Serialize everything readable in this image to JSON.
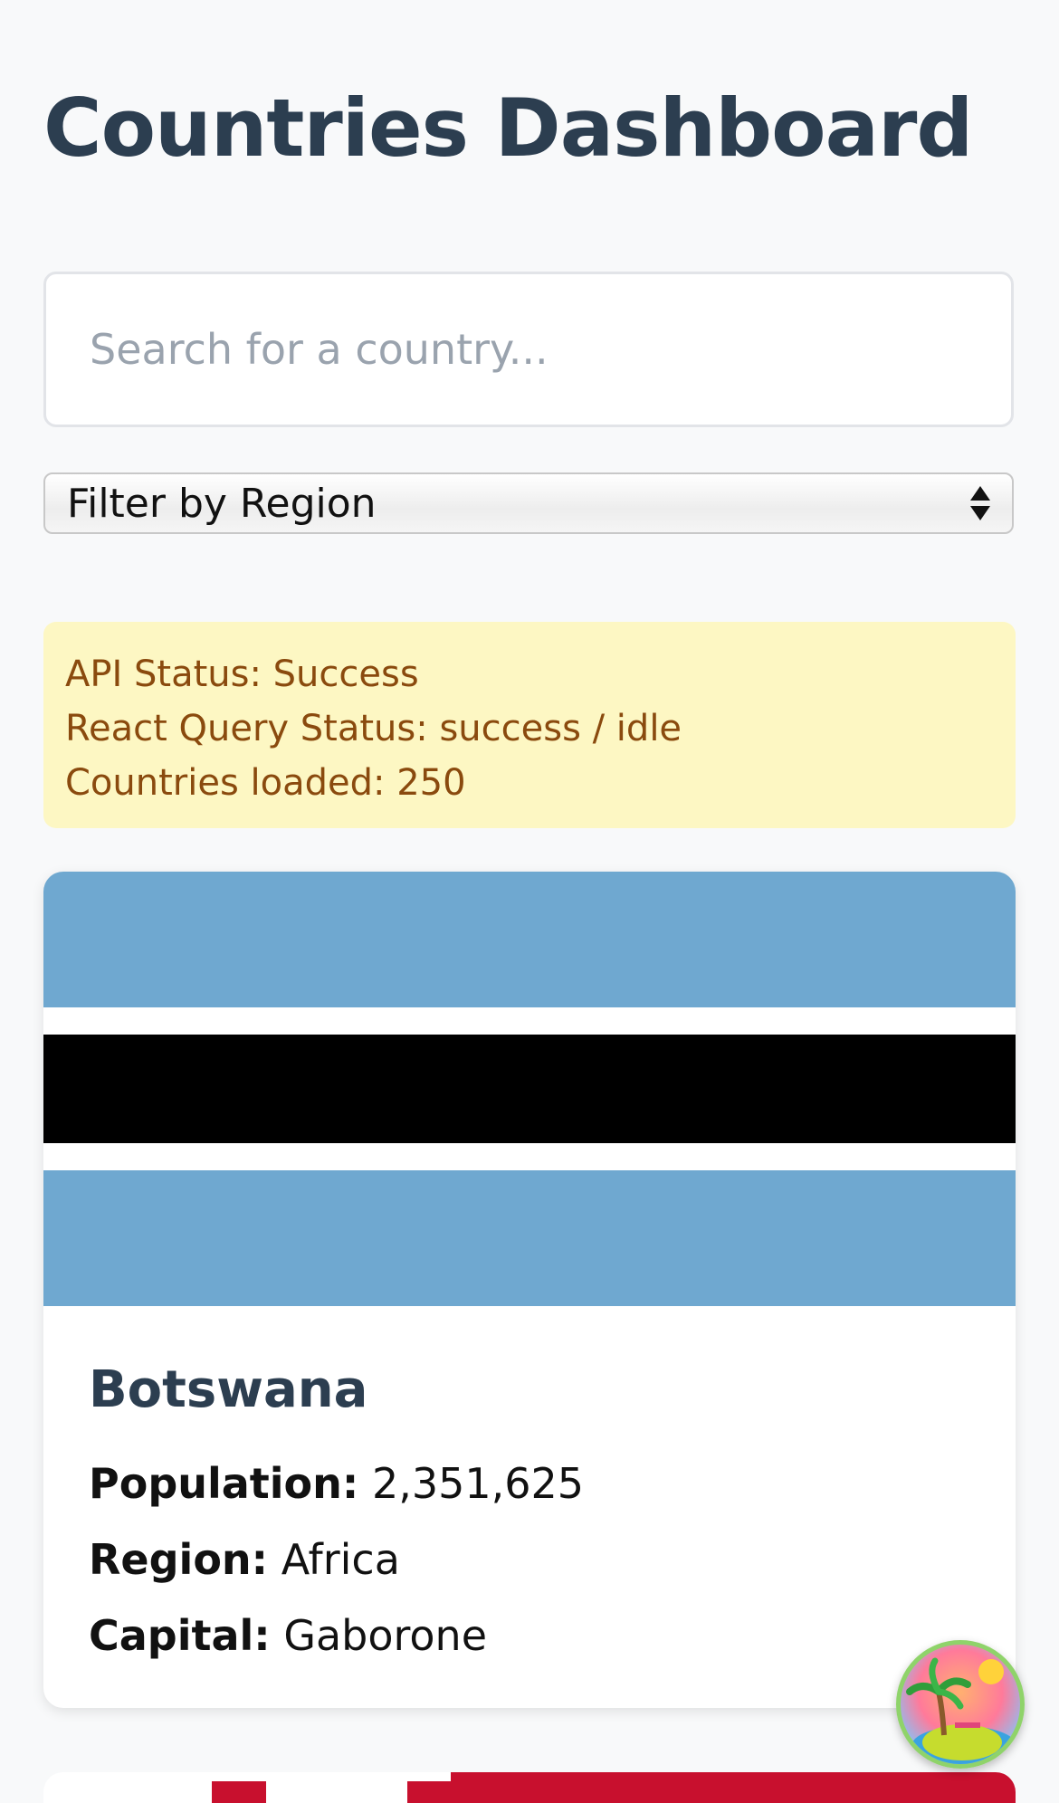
{
  "header": {
    "title": "Countries Dashboard"
  },
  "search": {
    "placeholder": "Search for a country...",
    "value": ""
  },
  "filter": {
    "selected_label": "Filter by Region"
  },
  "status": {
    "api_status": "API Status: Success",
    "query_status": "React Query Status: success / idle",
    "countries_loaded": "Countries loaded: 250"
  },
  "countries": [
    {
      "name": "Botswana",
      "population_label": "Population:",
      "population": "2,351,625",
      "region_label": "Region:",
      "region": "Africa",
      "capital_label": "Capital:",
      "capital": "Gaborone",
      "flag_colors": {
        "blue": "#6fa8d0",
        "white": "#ffffff",
        "black": "#000000"
      }
    }
  ],
  "next_card": {
    "flag_colors": {
      "red": "#c8102e",
      "white": "#ffffff"
    }
  },
  "fab": {
    "icon": "tropical-island-icon"
  },
  "colors": {
    "title": "#2c3e50",
    "status_bg": "#fdf7c3",
    "status_text": "#8a4a0e",
    "page_bg": "#f8f9fa"
  }
}
